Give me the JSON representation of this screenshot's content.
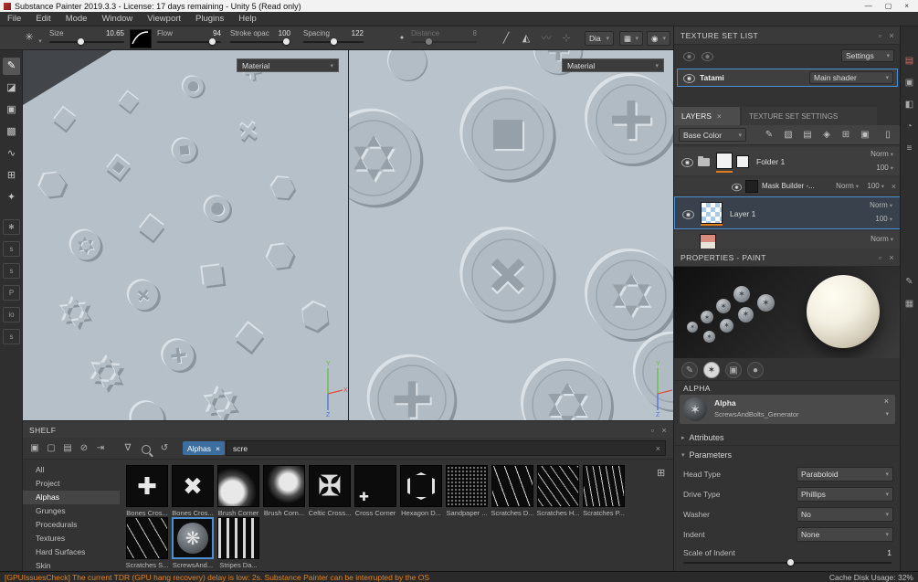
{
  "window": {
    "title": "Substance Painter 2019.3.3 - License: 17 days remaining - Unity 5 (Read only)",
    "menus": [
      "File",
      "Edit",
      "Mode",
      "Window",
      "Viewport",
      "Plugins",
      "Help"
    ]
  },
  "icons": {
    "minimize": "—",
    "maximize": "▢",
    "close": "×",
    "float": "▫",
    "chevron": "▾",
    "arrow_collapsed": "▸",
    "arrow_expanded": "▾",
    "brush_preset": "✳",
    "dot": "●",
    "stroke_line": "╱",
    "mirror": "◭",
    "lazy_mouse": "〰",
    "grid_snap": "⊹",
    "projection_cube": "▦",
    "camera": "◉",
    "star": "✶",
    "stencil": "▣",
    "sphere": "●",
    "filter": "∇",
    "refresh": "↺",
    "grid_view": "⊞",
    "tools": [
      "✎",
      "◪",
      "▣",
      "▩",
      "∿",
      "⊞",
      "✦"
    ],
    "plugins": [
      "✱",
      "s",
      "s",
      "P",
      "io",
      "s"
    ],
    "effects": [
      "✎",
      "▧",
      "▤",
      "◈",
      "⊞",
      "▣",
      "▯"
    ],
    "shelf_files": [
      "▣",
      "▢",
      "▤",
      "⊘",
      "⇥"
    ],
    "strip": [
      "▤",
      "▣",
      "◧",
      "◔",
      "≡",
      "✎",
      "▦"
    ]
  },
  "toolbar": {
    "size_label": "Size",
    "size_value": "10.65",
    "flow_label": "Flow",
    "flow_value": "94",
    "stroke_label": "Stroke opac",
    "stroke_value": "100",
    "spacing_label": "Spacing",
    "spacing_value": "122",
    "distance_label": "Distance",
    "distance_value": "8",
    "align_label": "Dia"
  },
  "viewport": {
    "left_material": "Material",
    "right_material": "Material",
    "axis": {
      "x": "X",
      "y": "Y",
      "z": "Z"
    }
  },
  "texture_set": {
    "title": "TEXTURE SET LIST",
    "settings": "Settings",
    "name": "Tatami",
    "shader": "Main shader"
  },
  "layers": {
    "tab_layers": "LAYERS",
    "tab_tss": "TEXTURE SET SETTINGS",
    "channel": "Base Color",
    "rows": [
      {
        "name": "Folder 1",
        "blend": "Norm",
        "opacity": "100"
      },
      {
        "name": "Mask Builder -...",
        "blend": "Norm",
        "opacity": "100"
      },
      {
        "name": "Layer 1",
        "blend": "Norm",
        "opacity": "100"
      },
      {
        "name": "",
        "blend": "Norm",
        "opacity": ""
      }
    ]
  },
  "properties": {
    "title": "PROPERTIES - PAINT",
    "alpha_header": "ALPHA",
    "alpha_title": "Alpha",
    "alpha_resource": "ScrewsAndBolts_Generator",
    "attributes": "Attributes",
    "parameters": "Parameters",
    "params": [
      {
        "label": "Head Type",
        "value": "Paraboloid"
      },
      {
        "label": "Drive Type",
        "value": "Phillips"
      },
      {
        "label": "Washer",
        "value": "No"
      },
      {
        "label": "Indent",
        "value": "None"
      },
      {
        "label": "Scale of Indent",
        "value": "1"
      }
    ]
  },
  "shelf": {
    "title": "SHELF",
    "tag": "Alphas",
    "search_value": "scre",
    "categories": [
      "All",
      "Project",
      "Alphas",
      "Grunges",
      "Procedurals",
      "Textures",
      "Hard Surfaces",
      "Skin"
    ],
    "row1": [
      {
        "label": "Bones Cros...",
        "glyph": "✚"
      },
      {
        "label": "Bones Cros...",
        "glyph": "✖"
      },
      {
        "label": "Brush Corner",
        "glyph": ""
      },
      {
        "label": "Brush Corn...",
        "glyph": ""
      },
      {
        "label": "Celtic Cross...",
        "glyph": "✠"
      },
      {
        "label": "Cross Corner",
        "glyph": "✚"
      },
      {
        "label": "Hexagon D...",
        "glyph": ""
      },
      {
        "label": "Sandpaper ...",
        "glyph": ""
      },
      {
        "label": "Scratches D...",
        "glyph": ""
      },
      {
        "label": "Scratches H...",
        "glyph": ""
      },
      {
        "label": "Scratches P...",
        "glyph": ""
      }
    ],
    "row2": [
      {
        "label": "Scratches S...",
        "glyph": ""
      },
      {
        "label": "ScrewsAnd...",
        "glyph": "❋"
      },
      {
        "label": "Stripes Da...",
        "glyph": ""
      }
    ]
  },
  "status": {
    "warning": "[GPUIssuesCheck] The current TDR (GPU hang recovery) delay is low: 2s. Substance Painter can be interrupted by the OS",
    "cache": "Cache Disk Usage: 32%"
  }
}
